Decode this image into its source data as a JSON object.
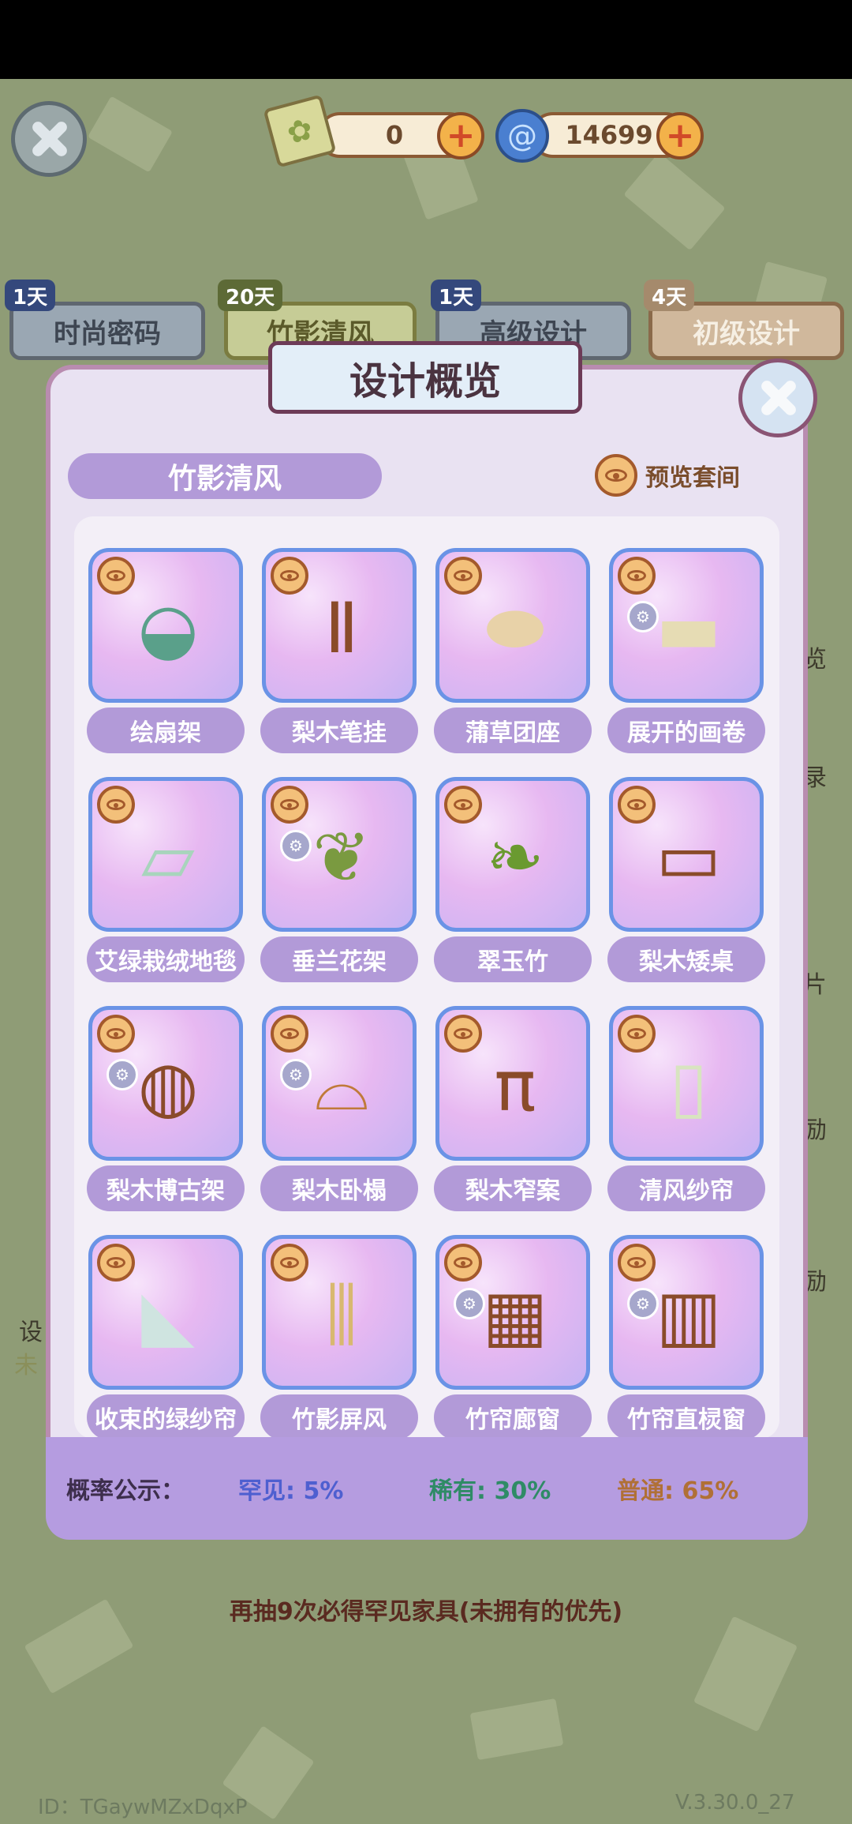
{
  "header": {
    "ticket_count": "0",
    "swirl_count": "14699",
    "ticket_icon": "ticket-leaf-icon",
    "swirl_icon": "blue-swirl-icon"
  },
  "tabs": [
    {
      "days": "1天",
      "label": "时尚密码"
    },
    {
      "days": "20天",
      "label": "竹影清风"
    },
    {
      "days": "1天",
      "label": "高级设计"
    },
    {
      "days": "4天",
      "label": "初级设计"
    }
  ],
  "side_labels": [
    "览",
    "录",
    "片",
    "励",
    "励",
    "设",
    "未"
  ],
  "modal": {
    "title": "设计概览",
    "set_name": "竹影清风",
    "preview_label": "预览套间",
    "items": [
      {
        "label": "绘扇架",
        "badge": false,
        "icon": "fan-stand-icon"
      },
      {
        "label": "梨木笔挂",
        "badge": false,
        "icon": "brush-rack-icon"
      },
      {
        "label": "蒲草团座",
        "badge": false,
        "icon": "round-cushion-icon"
      },
      {
        "label": "展开的画卷",
        "badge": true,
        "icon": "scroll-painting-icon"
      },
      {
        "label": "艾绿栽绒地毯",
        "badge": false,
        "icon": "green-rug-icon"
      },
      {
        "label": "垂兰花架",
        "badge": true,
        "icon": "orchid-stand-icon"
      },
      {
        "label": "翠玉竹",
        "badge": false,
        "icon": "bamboo-plant-icon"
      },
      {
        "label": "梨木矮桌",
        "badge": false,
        "icon": "low-table-icon"
      },
      {
        "label": "梨木博古架",
        "badge": true,
        "icon": "curio-shelf-icon"
      },
      {
        "label": "梨木卧榻",
        "badge": true,
        "icon": "daybed-icon"
      },
      {
        "label": "梨木窄案",
        "badge": false,
        "icon": "narrow-table-icon"
      },
      {
        "label": "清风纱帘",
        "badge": false,
        "icon": "gauze-curtain-icon"
      },
      {
        "label": "收束的绿纱帘",
        "badge": false,
        "icon": "tied-curtain-icon"
      },
      {
        "label": "竹影屏风",
        "badge": false,
        "icon": "folding-screen-icon"
      },
      {
        "label": "竹帘廊窗",
        "badge": true,
        "icon": "bamboo-window-icon"
      },
      {
        "label": "竹帘直棂窗",
        "badge": true,
        "icon": "lattice-window-icon"
      }
    ],
    "probability": {
      "title": "概率公示：",
      "rare": "罕见: 5%",
      "uncommon": "稀有: 30%",
      "common": "普通: 65%"
    }
  },
  "bottom_note": "再抽9次必得罕见家具(未拥有的优先)",
  "footer": {
    "id": "ID：TGaywMZxDqxP",
    "version": "V.3.30.0_27"
  },
  "colors": {
    "label_purple": "#b29ad8",
    "card_border": "#6a93e6",
    "rare": "#4e5fd0",
    "uncommon": "#2f8b66",
    "common": "#b07036"
  }
}
